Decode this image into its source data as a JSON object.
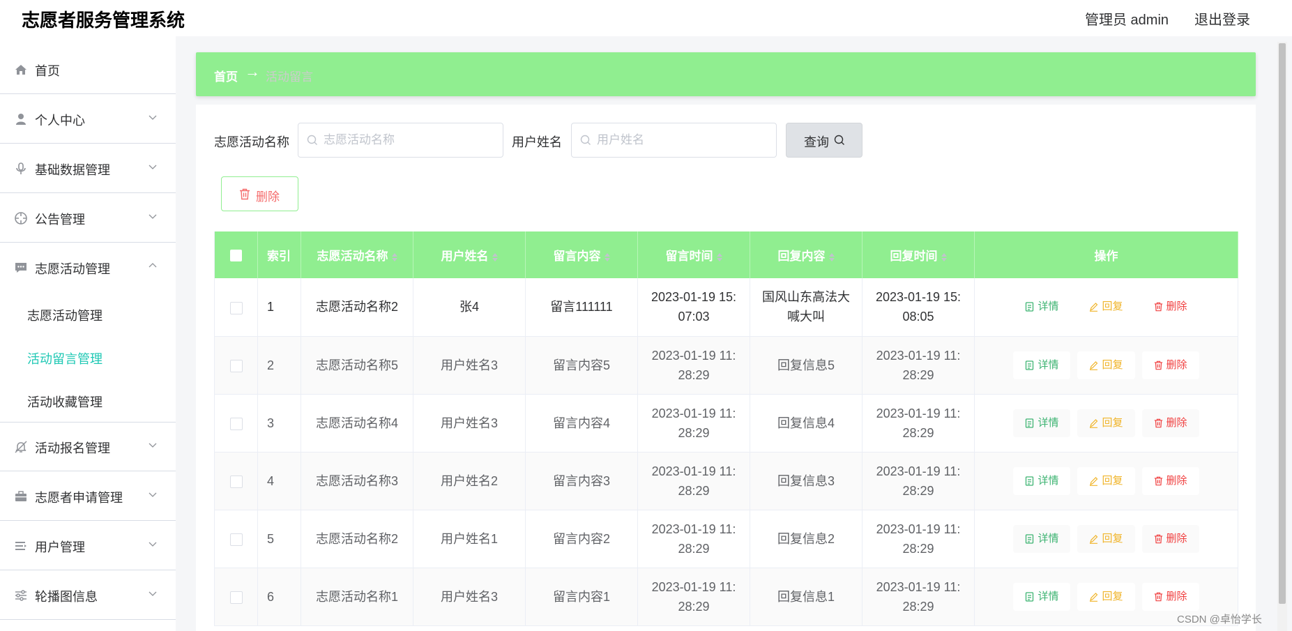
{
  "header": {
    "title": "志愿者服务管理系统",
    "user": "管理员 admin",
    "logout": "退出登录"
  },
  "sidebar": {
    "items": [
      {
        "label": "首页",
        "icon": "home-icon"
      },
      {
        "label": "个人中心",
        "icon": "user-icon"
      },
      {
        "label": "基础数据管理",
        "icon": "microphone-icon"
      },
      {
        "label": "公告管理",
        "icon": "crosshair-icon"
      },
      {
        "label": "志愿活动管理",
        "icon": "chat-icon"
      },
      {
        "label": "活动报名管理",
        "icon": "bell-off-icon"
      },
      {
        "label": "志愿者申请管理",
        "icon": "briefcase-icon"
      },
      {
        "label": "用户管理",
        "icon": "list-icon"
      },
      {
        "label": "轮播图信息",
        "icon": "sliders-icon"
      }
    ],
    "submenu": [
      {
        "label": "志愿活动管理"
      },
      {
        "label": "活动留言管理",
        "active": true
      },
      {
        "label": "活动收藏管理"
      }
    ]
  },
  "breadcrumb": {
    "home": "首页",
    "arrow": "→",
    "current": "活动留言"
  },
  "filters": {
    "activity_label": "志愿活动名称",
    "activity_placeholder": "志愿活动名称",
    "user_label": "用户姓名",
    "user_placeholder": "用户姓名",
    "query_label": "查询"
  },
  "actions": {
    "delete_label": "删除"
  },
  "table": {
    "columns": [
      "索引",
      "志愿活动名称",
      "用户姓名",
      "留言内容",
      "留言时间",
      "回复内容",
      "回复时间",
      "操作"
    ],
    "ops": {
      "detail": "详情",
      "reply": "回复",
      "remove": "删除"
    },
    "rows": [
      {
        "index": "1",
        "activity": "志愿活动名称2",
        "user": "张4",
        "content": "留言111111",
        "time1": "2023-01-19 15:",
        "time2": "07:03",
        "reply1": "国风山东高法大",
        "reply2": "喊大叫",
        "rtime1": "2023-01-19 15:",
        "rtime2": "08:05"
      },
      {
        "index": "2",
        "activity": "志愿活动名称5",
        "user": "用户姓名3",
        "content": "留言内容5",
        "time1": "2023-01-19 11:",
        "time2": "28:29",
        "reply1": "回复信息5",
        "reply2": "",
        "rtime1": "2023-01-19 11:",
        "rtime2": "28:29"
      },
      {
        "index": "3",
        "activity": "志愿活动名称4",
        "user": "用户姓名3",
        "content": "留言内容4",
        "time1": "2023-01-19 11:",
        "time2": "28:29",
        "reply1": "回复信息4",
        "reply2": "",
        "rtime1": "2023-01-19 11:",
        "rtime2": "28:29"
      },
      {
        "index": "4",
        "activity": "志愿活动名称3",
        "user": "用户姓名2",
        "content": "留言内容3",
        "time1": "2023-01-19 11:",
        "time2": "28:29",
        "reply1": "回复信息3",
        "reply2": "",
        "rtime1": "2023-01-19 11:",
        "rtime2": "28:29"
      },
      {
        "index": "5",
        "activity": "志愿活动名称2",
        "user": "用户姓名1",
        "content": "留言内容2",
        "time1": "2023-01-19 11:",
        "time2": "28:29",
        "reply1": "回复信息2",
        "reply2": "",
        "rtime1": "2023-01-19 11:",
        "rtime2": "28:29"
      },
      {
        "index": "6",
        "activity": "志愿活动名称1",
        "user": "用户姓名3",
        "content": "留言内容1",
        "time1": "2023-01-19 11:",
        "time2": "28:29",
        "reply1": "回复信息1",
        "reply2": "",
        "rtime1": "2023-01-19 11:",
        "rtime2": "28:29"
      }
    ]
  },
  "watermark": "CSDN @卓怡学长",
  "colors": {
    "accent": "#90ee90",
    "active_menu": "#1fc8b4",
    "detail": "#3cb371",
    "reply": "#f0b429",
    "remove": "#f04040"
  }
}
